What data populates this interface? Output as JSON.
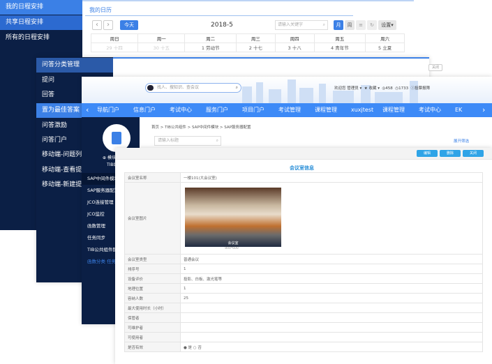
{
  "calendar": {
    "sidebar": [
      "我的日程安排",
      "共享日程安排",
      "所有的日程安排"
    ],
    "title": "我的日历",
    "prev": "‹",
    "next": "›",
    "today": "今天",
    "month_label": "2018-5",
    "search_placeholder": "请输入关键字",
    "view_month": "月",
    "view_week": "周",
    "view_list": "≡",
    "refresh": "↻",
    "settings": "设置▾",
    "weekdays": [
      "周日",
      "周一",
      "周二",
      "周三",
      "周四",
      "周五",
      "周六"
    ],
    "days": [
      {
        "d": "29",
        "l": "十四",
        "muted": true
      },
      {
        "d": "30",
        "l": "十五",
        "muted": true
      },
      {
        "d": "1",
        "l": "劳动节"
      },
      {
        "d": "2",
        "l": "十七"
      },
      {
        "d": "3",
        "l": "十八"
      },
      {
        "d": "4",
        "l": "青年节"
      },
      {
        "d": "5",
        "l": "立夏"
      }
    ]
  },
  "qa": {
    "sidebar": [
      "问答分类管理",
      "提问",
      "回答",
      "置为最佳答案",
      "问答激励",
      "问答门户",
      "移动端-问题列表",
      "移动端-查看提问",
      "移动端-新建提问"
    ],
    "close": "关闭"
  },
  "portal": {
    "search_placeholder": "找人、搜知识、查会议",
    "user": {
      "welcome": "欢迎您 管理员 ▾",
      "favorites": "★ 收藏 ▾",
      "count1": "458",
      "count2": "1733",
      "feedback": "投票报障"
    },
    "nav": [
      "导航门户",
      "信息门户",
      "考试中心",
      "服务门户",
      "项目门户",
      "考试管理",
      "课程管理",
      "xuxjtest",
      "课程管理",
      "考试中心",
      "EK"
    ],
    "sidebar_title": "TIB组件",
    "sidebar_add": "模块",
    "sidebar": [
      "SAP中间件模块",
      "SAP服务器配置",
      "JCO连接管理",
      "JCO监控",
      "函数管理",
      "任务同步",
      "TIB公共组件配置",
      "函数分类 任务"
    ],
    "breadcrumb": [
      "首页",
      "TIB公共组件",
      "SAP中间件模块",
      "SAP服务器配置"
    ],
    "filter_placeholder": "请输入标题",
    "expand_filter": "展开筛选"
  },
  "detail": {
    "buttons": [
      "编辑",
      "删除",
      "关闭"
    ],
    "title": "会议室信息",
    "image_caption": "800*600",
    "image_label": "会议室",
    "rows": [
      {
        "k": "会议室名称",
        "v": "一楼101(大会议室)"
      },
      {
        "k": "会议室图片",
        "v": ""
      },
      {
        "k": "会议室类型",
        "v": "普通会议"
      },
      {
        "k": "排序号",
        "v": "1"
      },
      {
        "k": "设备评价",
        "v": "投影、白板、激光笔等"
      },
      {
        "k": "地理位置",
        "v": "1"
      },
      {
        "k": "容纳人数",
        "v": "25"
      },
      {
        "k": "最大使用时长（小时）",
        "v": ""
      },
      {
        "k": "保管者",
        "v": ""
      },
      {
        "k": "可维护者",
        "v": ""
      },
      {
        "k": "可使用者",
        "v": ""
      },
      {
        "k": "是否有效",
        "v": "● 是  ○ 否"
      }
    ]
  }
}
